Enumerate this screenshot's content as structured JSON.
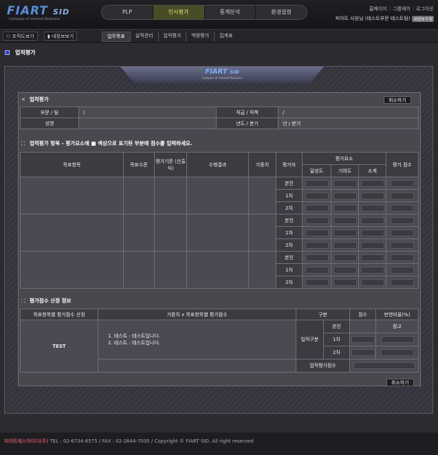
{
  "header": {
    "logo": "FIART",
    "logo_suffix": "SID",
    "logo_tagline": "Compass of internet Business",
    "nav": [
      "PLP",
      "인사평가",
      "통계분석",
      "환경설정"
    ],
    "util_links": [
      "홈페이지",
      "그룹웨어",
      "로그아웃"
    ],
    "user": "피아트 사원님 (테스트부문 테스트팀)",
    "logout_badge": "내정보수정"
  },
  "subbar": {
    "org_chart": "조직도보기",
    "my_info": "내정보보기",
    "tabs": [
      "업무목표",
      "실적관리",
      "업적평가",
      "역량평가",
      "집계표"
    ]
  },
  "page": {
    "title": "업적평가"
  },
  "frame_logo": {
    "name": "FIART",
    "suffix": "SID",
    "tagline": "Compass of internet Business"
  },
  "section1": {
    "title": "업적평가",
    "cancel": "취소하기",
    "rows": [
      {
        "l1": "부문 / 팀",
        "v1": "/",
        "l2": "직급 / 직책",
        "v2": "/"
      },
      {
        "l1": "성명",
        "v1": "",
        "l2": "년도 / 분기",
        "v2": "년 / 분기"
      }
    ]
  },
  "section2": {
    "title": "업적평가 항목 - 평가요소에 ■ 색상으로 표기된 부분에 점수를 입력하세요.",
    "headers": {
      "goal": "목표항목",
      "level": "목표수준",
      "criteria": "평가기준 (산출식)",
      "result": "수행결과",
      "weight": "가중치",
      "evaluator": "평가자",
      "factors": "평가요소",
      "achieve": "달성도",
      "contribution": "기여도",
      "subtotal": "소계",
      "score": "평가 점수"
    },
    "evaluators": [
      "본인",
      "1차",
      "2차"
    ]
  },
  "section3": {
    "title": "평가점수 산정 정보",
    "h_calc": "목표항목별 평가점수 산정",
    "h_formula": "가중치 x 목표항목별 평가점수",
    "h_type": "구분",
    "h_score": "점수",
    "h_ratio": "반영비율(%)",
    "test_label": "TEST",
    "notes": [
      "1. 테스트 : 테스트입니다.",
      "2. 테스트 : 테스트입니다."
    ],
    "group": "업적구분",
    "evaluators": [
      "본인",
      "1차",
      "2차"
    ],
    "self_ratio": "참고",
    "total_label": "업적평가점수",
    "cancel": "취소하기"
  },
  "footer": {
    "brand": "피아트에스아이디(주)",
    "text": "TEL : 02-6734-8575  /  FAX : 02-2644-7035  /  Copyright © FIART SID. All right reserved"
  }
}
